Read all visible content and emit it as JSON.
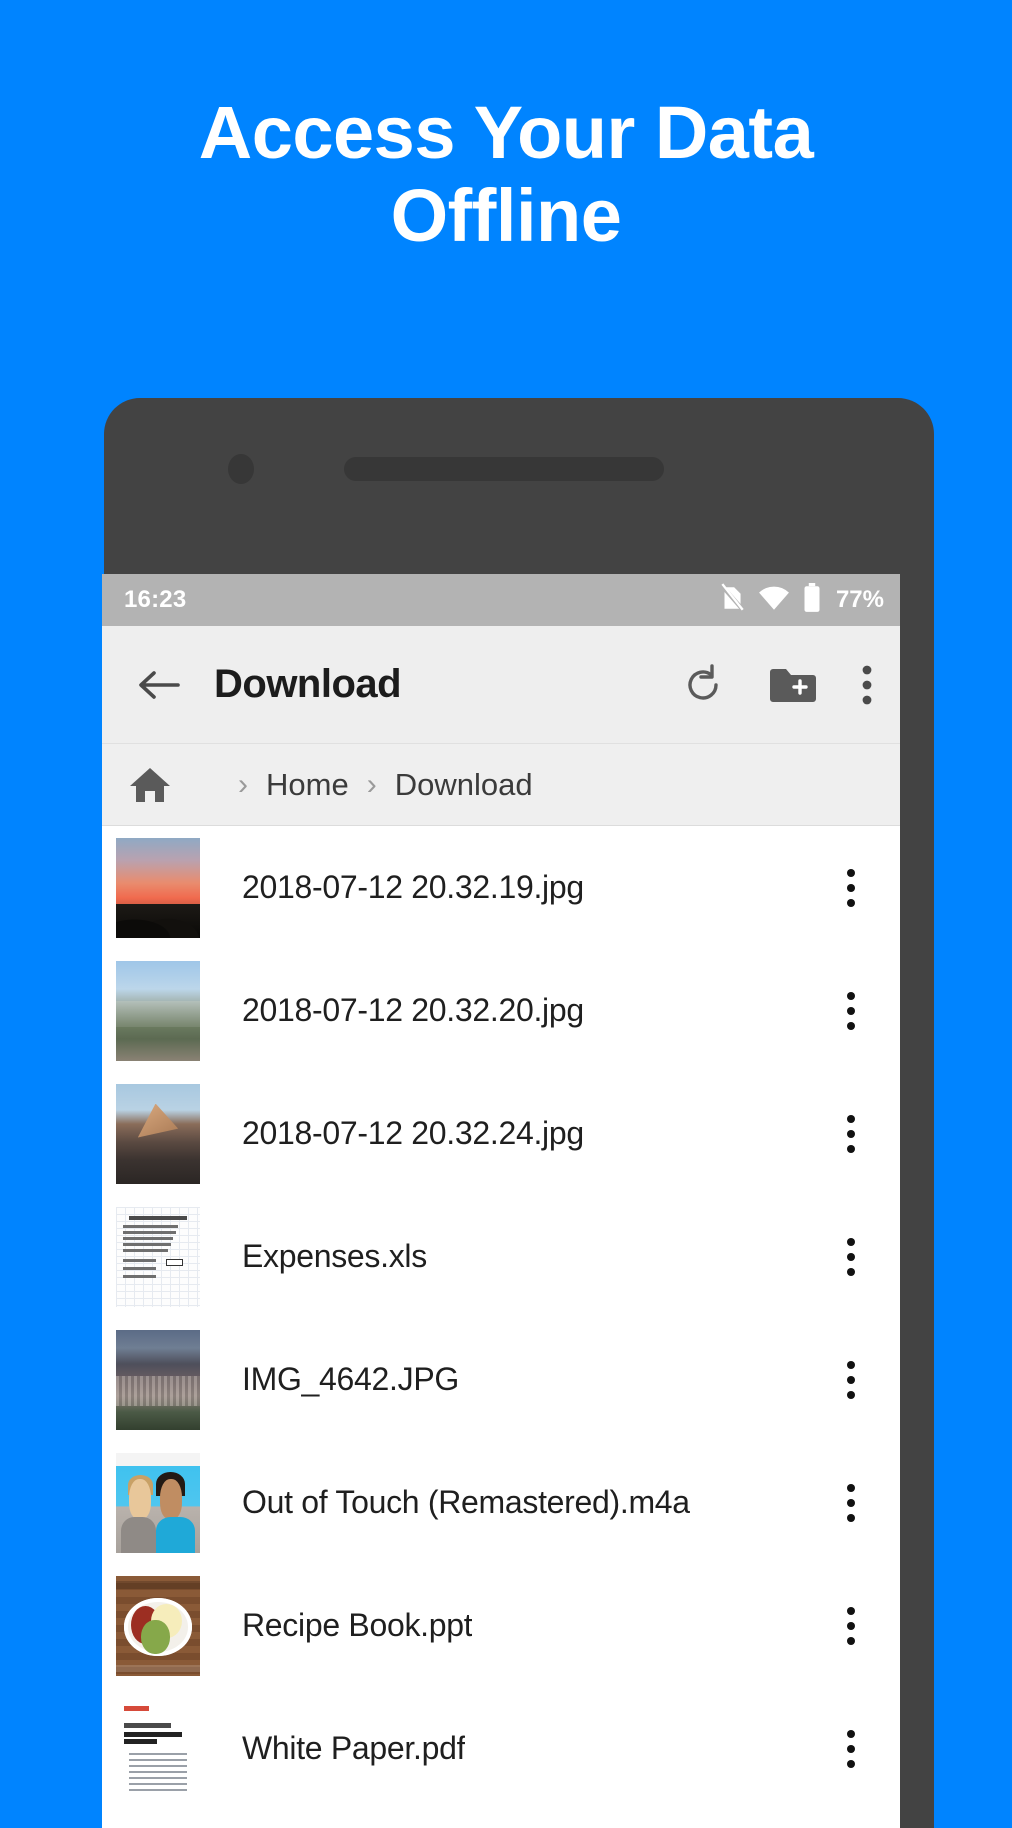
{
  "headline": {
    "line1": "Access Your Data",
    "line2": "Offline"
  },
  "theme": {
    "background": "#0084ff",
    "phone_frame": "#434343",
    "status_bar": "#b3b3b3",
    "toolbar": "#eeeeee",
    "breadcrumb_bar": "#efefef",
    "list_bg": "#ffffff",
    "text": "#1f1f1f"
  },
  "status_bar": {
    "time": "16:23",
    "battery_percent": "77%",
    "icons": [
      "no-sim-icon",
      "wifi-icon",
      "battery-icon"
    ]
  },
  "toolbar": {
    "back_label": "back-arrow-icon",
    "title": "Download",
    "actions": [
      {
        "name": "refresh-button",
        "icon": "refresh-icon"
      },
      {
        "name": "new-folder-button",
        "icon": "new-folder-icon"
      },
      {
        "name": "overflow-menu-button",
        "icon": "more-vertical-icon"
      }
    ]
  },
  "breadcrumb": {
    "home_icon": "home-icon",
    "separator": "›",
    "items": [
      "Home",
      "Download"
    ]
  },
  "file_list": [
    {
      "name": "2018-07-12 20.32.19.jpg",
      "thumb": "t-sunset",
      "kind": "image"
    },
    {
      "name": "2018-07-12 20.32.20.jpg",
      "thumb": "t-valley",
      "kind": "image"
    },
    {
      "name": "2018-07-12 20.32.24.jpg",
      "thumb": "t-peak",
      "kind": "image"
    },
    {
      "name": "Expenses.xls",
      "thumb": "t-sheet",
      "kind": "spreadsheet"
    },
    {
      "name": "IMG_4642.JPG",
      "thumb": "t-city",
      "kind": "image"
    },
    {
      "name": "Out of Touch (Remastered).m4a",
      "thumb": "t-album",
      "kind": "audio"
    },
    {
      "name": "Recipe Book.ppt",
      "thumb": "t-recipe",
      "kind": "presentation"
    },
    {
      "name": "White Paper.pdf",
      "thumb": "t-pdf",
      "kind": "pdf"
    }
  ]
}
